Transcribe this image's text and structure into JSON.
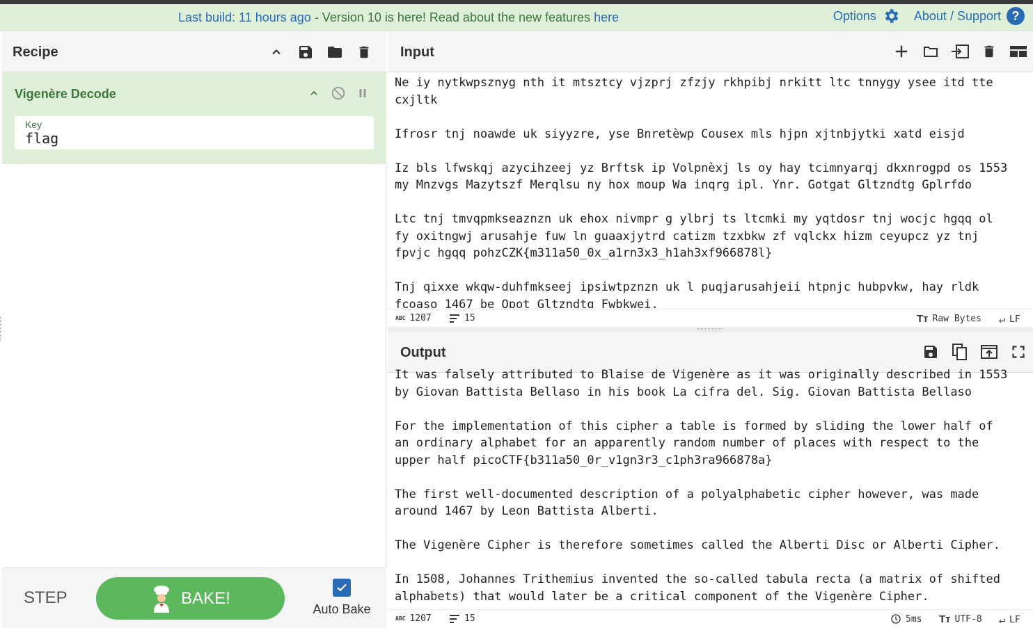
{
  "banner": {
    "last_build": "Last build: 11 hours ago",
    "version_msg": " - Version 10 is here! Read about the new features ",
    "here_link": "here",
    "options": "Options",
    "about": "About / Support",
    "help_glyph": "?"
  },
  "recipe": {
    "title": "Recipe",
    "operation": {
      "name": "Vigenère Decode",
      "key_label": "Key",
      "key_value": "flag"
    }
  },
  "bake": {
    "step_label": "STEP",
    "bake_label": "BAKE!",
    "auto_bake_label": "Auto Bake",
    "auto_bake_checked": true
  },
  "input": {
    "title": "Input",
    "text": "Ne iy nytkwpsznyg nth it mtsztcy vjzprj zfzjy rkhpibj nrkitt ltc tnnygy ysee itd tte\ncxjltk\n\nIfrosr tnj noawde uk siyyzre, yse Bnretèwp Cousex mls hjpn xjtnbjytki xatd eisjd\n\nIz bls lfwskqj azycihzeej yz Brftsk ip Volpnèxj ls oy hay tcimnyarqj dkxnrogpd os 1553\nmy Mnzvgs Mazytszf Merqlsu ny hox moup Wa inqrg ipl. Ynr. Gotgat Gltzndtg Gplrfdo\n\nLtc tnj tmvqpmkseaznzn uk ehox nivmpr g ylbrj ts ltcmki my yqtdosr tnj wocjc hgqq ol\nfy oxitngwj arusahje fuw ln guaaxjytrd catizm tzxbkw zf vqlckx hizm ceyupcz yz tnj\nfpvjc hgqq pohzCZK{m311a50_0x_a1rn3x3_h1ah3xf966878l}\n\nTnj qixxe wkqw-duhfmkseej ipsiwtpznzn uk l puqjarusahjeii htpnjc hubpvkw, hay rldk\nfcoaso 1467 be Opot Gltzndtg Fwbkwei.",
    "length": "1207",
    "lines": "15",
    "encoding": "Raw Bytes",
    "eol": "LF"
  },
  "output": {
    "title": "Output",
    "text": "It was falsely attributed to Blaise de Vigenère as it was originally described in 1553\nby Giovan Battista Bellaso in his book La cifra del. Sig. Giovan Battista Bellaso\n\nFor the implementation of this cipher a table is formed by sliding the lower half of\nan ordinary alphabet for an apparently random number of places with respect to the\nupper half picoCTF{b311a50_0r_v1gn3r3_c1ph3ra966878a}\n\nThe first well-documented description of a polyalphabetic cipher however, was made\naround 1467 by Leon Battista Alberti.\n\nThe Vigenère Cipher is therefore sometimes called the Alberti Disc or Alberti Cipher.\n\nIn 1508, Johannes Trithemius invented the so-called tabula recta (a matrix of shifted\nalphabets) that would later be a critical component of the Vigenère Cipher.",
    "length": "1207",
    "lines": "15",
    "time": "5ms",
    "encoding": "UTF-8",
    "eol": "LF"
  },
  "colors": {
    "banner_bg": "#dff0d8",
    "banner_text": "#3c763d",
    "link": "#2a6bb5",
    "operation_bg": "#dff0d8",
    "bake_button": "#5cb85c"
  }
}
